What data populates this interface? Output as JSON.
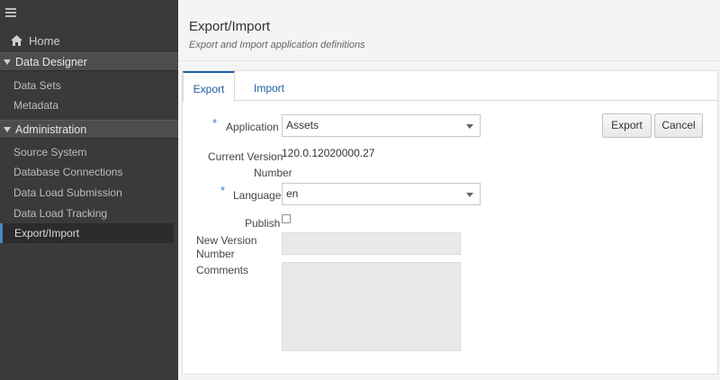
{
  "sidebar": {
    "home_label": "Home",
    "sections": [
      {
        "label": "Data Designer",
        "items": [
          "Data Sets",
          "Metadata"
        ]
      },
      {
        "label": "Administration",
        "items": [
          "Source System",
          "Database Connections",
          "Data Load Submission",
          "Data Load Tracking",
          "Export/Import"
        ]
      }
    ],
    "active_item": "Export/Import"
  },
  "header": {
    "title": "Export/Import",
    "subtitle": "Export and Import application definitions"
  },
  "tabs": [
    {
      "label": "Export",
      "active": true
    },
    {
      "label": "Import",
      "active": false
    }
  ],
  "form": {
    "required_marker": "*",
    "application_label": "Application",
    "application_value": "Assets",
    "current_version_label_1": "Current Version",
    "current_version_label_2": "Number",
    "current_version_value": "120.0.12020000.27",
    "language_label": "Language",
    "language_value": "en",
    "publish_label": "Publish",
    "publish_checked": false,
    "new_version_label_1": "New Version",
    "new_version_label_2": "Number",
    "comments_label": "Comments"
  },
  "actions": {
    "export_label": "Export",
    "cancel_label": "Cancel"
  },
  "colors": {
    "sidebar_bg": "#3a3a3a",
    "accent": "#1f5fa5",
    "required": "#3f7ac2"
  }
}
